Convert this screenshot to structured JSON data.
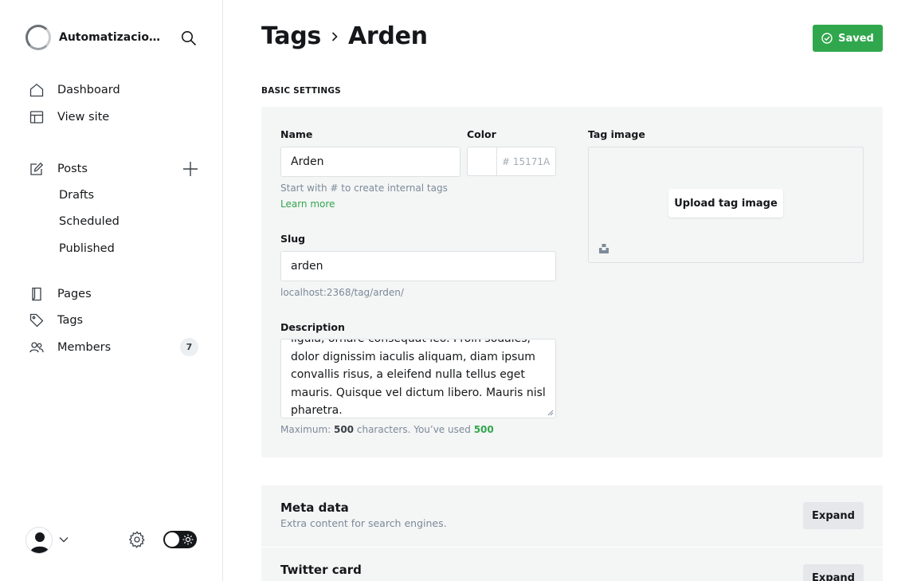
{
  "sidebar": {
    "site_name": "Automatizacion...",
    "nav": {
      "dashboard": "Dashboard",
      "view_site": "View site",
      "posts": "Posts",
      "drafts": "Drafts",
      "scheduled": "Scheduled",
      "published": "Published",
      "pages": "Pages",
      "tags": "Tags",
      "members": "Members",
      "members_count": "7"
    }
  },
  "header": {
    "breadcrumb_parent": "Tags",
    "breadcrumb_current": "Arden",
    "saved_label": "Saved"
  },
  "form": {
    "section_label": "BASIC SETTINGS",
    "name_label": "Name",
    "name_value": "Arden",
    "name_hint": "Start with # to create internal tags",
    "learn_more": "Learn more",
    "color_label": "Color",
    "color_value": "# 15171A",
    "slug_label": "Slug",
    "slug_value": "arden",
    "slug_url": "localhost:2368/tag/arden/",
    "description_label": "Description",
    "description_value": "ligula, ornare consequat leo. Proin sodales, dolor dignissim iaculis aliquam, diam ipsum convallis risus, a eleifend nulla tellus eget mauris. Quisque vel dictum libero. Mauris nisl pharetra.",
    "counter_prefix": "Maximum: ",
    "counter_max": "500",
    "counter_mid": " characters. You’ve used ",
    "counter_used": "500",
    "tag_image_label": "Tag image",
    "upload_label": "Upload tag image"
  },
  "cards": {
    "meta_title": "Meta data",
    "meta_desc": "Extra content for search engines.",
    "meta_expand": "Expand",
    "twitter_title": "Twitter card",
    "twitter_expand": "Expand"
  },
  "colors": {
    "accent_green": "#30a74c",
    "text_dark": "#15171a",
    "muted": "#7c8b9a"
  }
}
